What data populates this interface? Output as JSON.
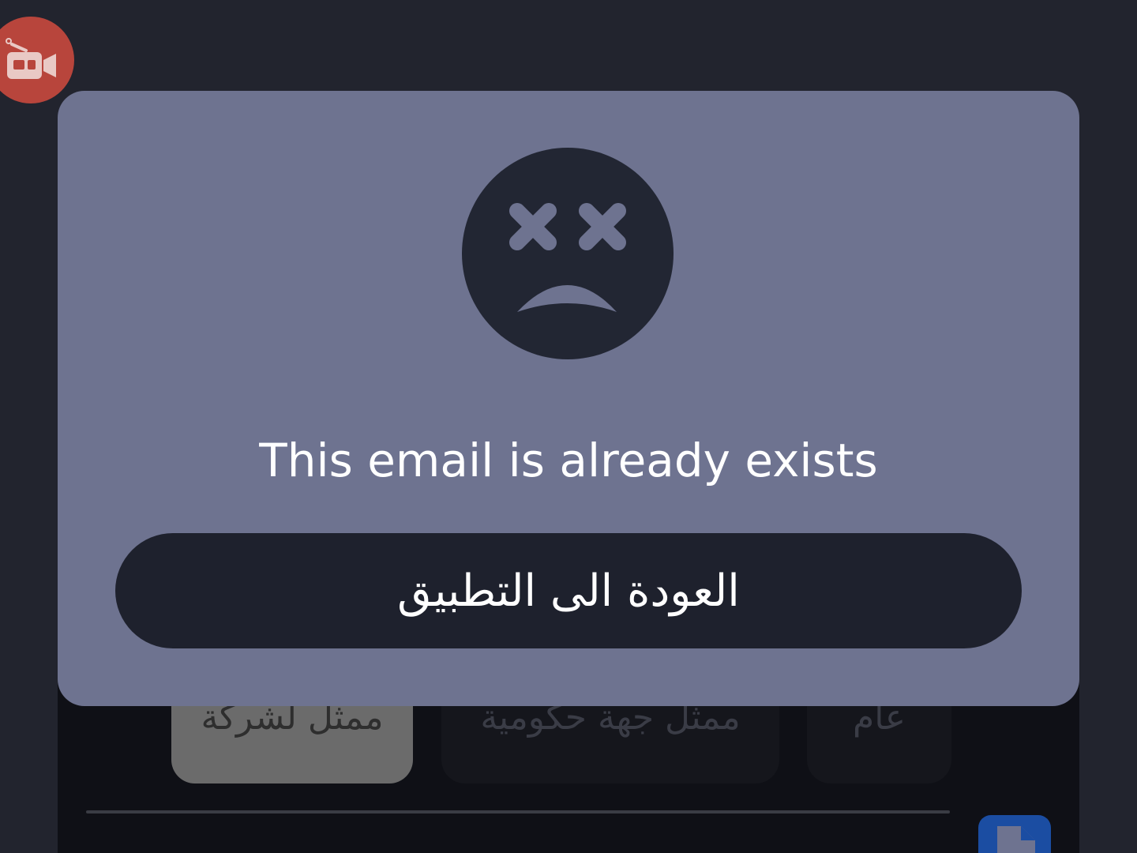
{
  "app": {
    "account_types": [
      {
        "label": "ممثل لشركة",
        "selected": true
      },
      {
        "label": "ممثل جهة حكومية",
        "selected": false
      },
      {
        "label": "عام",
        "selected": false
      }
    ]
  },
  "icons": {
    "record": "video-record-icon",
    "file": "file-icon",
    "error": "sad-face-icon"
  },
  "dialog": {
    "message": "This email is already exists",
    "back_button_label": "العودة الى التطبيق"
  },
  "colors": {
    "background": "#22242e",
    "dialog": "#6e7390",
    "button": "#1e212d",
    "record": "#b8453c",
    "file_button": "#1b4da2"
  }
}
